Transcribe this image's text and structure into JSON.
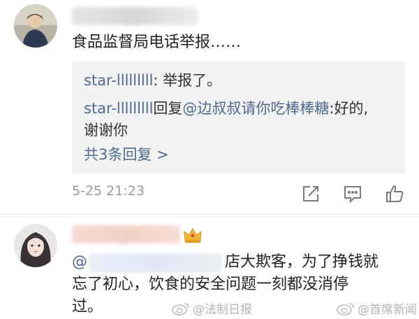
{
  "comment1": {
    "text": "食品监督局电话举报……",
    "replies": [
      {
        "user": "star-lllllllll",
        "sep": ": ",
        "text": "举报了。"
      },
      {
        "user": "star-lllllllll",
        "action": "回复",
        "target": "@边叔叔请你吃棒棒糖",
        "sep": ":",
        "text": "好的,",
        "text_cont": "谢谢你"
      }
    ],
    "more_replies": "共3条回复 >",
    "timestamp": "5-25 21:23"
  },
  "comment2": {
    "mention_prefix": "@",
    "line1_rest": "店大欺客，为了挣钱就",
    "line2": "忘了初心，饮食的安全问题一刻都没消停",
    "line3": "过。"
  },
  "watermarks": [
    "@法制日报",
    "@首席新闻"
  ],
  "colors": {
    "link": "#4d6a93",
    "reply_bg": "#f2f2f2",
    "muted": "#9a9a9a"
  }
}
